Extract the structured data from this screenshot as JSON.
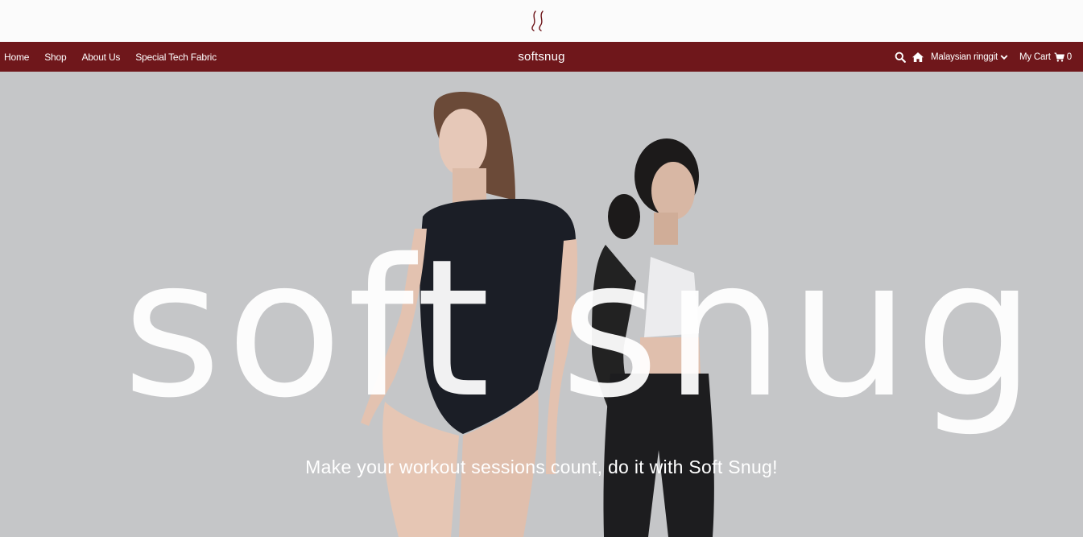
{
  "header": {
    "logo_icon": "softsnug-wave-logo-icon",
    "logo_color": "#6f171b"
  },
  "nav": {
    "background": "#6f171b",
    "links": [
      "Home",
      "Shop",
      "About Us",
      "Special Tech Fabric"
    ],
    "brand": "softsnug",
    "currency": "Malaysian ringgit",
    "cart_label": "My Cart",
    "cart_count": "0",
    "icons": [
      "search-icon",
      "home-icon",
      "chevron-down-icon",
      "cart-icon"
    ]
  },
  "hero": {
    "background": "#c5c6c8",
    "headline": "soft snug",
    "tagline": "Make your workout sessions count, do it with Soft Snug!"
  }
}
